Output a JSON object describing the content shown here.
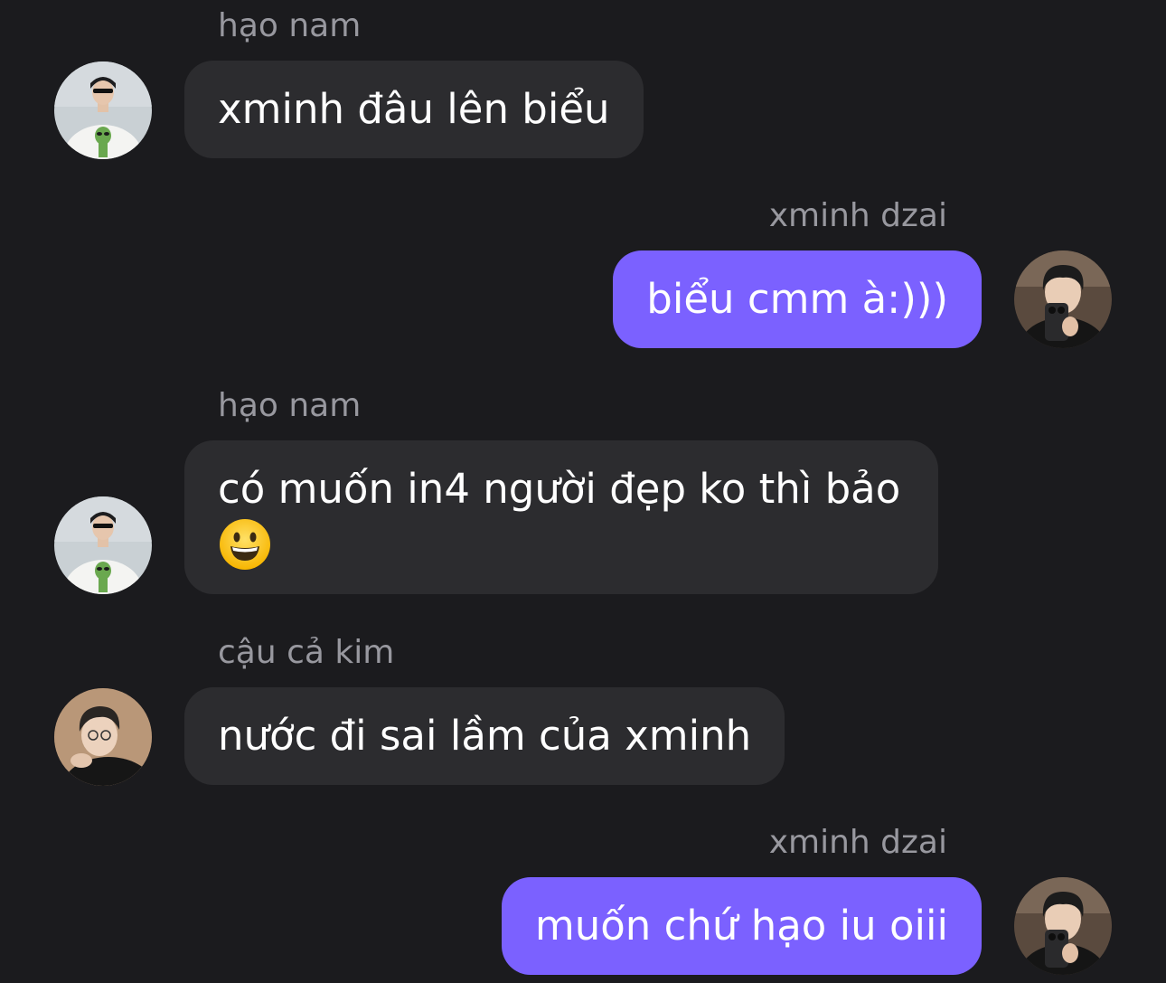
{
  "conversation": {
    "messages": [
      {
        "sender": "hạo nam",
        "text": "xminh đâu lên biểu",
        "side": "incoming",
        "avatar": "avatar-hao-nam"
      },
      {
        "sender": "xminh dzai",
        "text": "biểu cmm à:)))",
        "side": "outgoing",
        "avatar": "avatar-xminh"
      },
      {
        "sender": "hạo nam",
        "text": "có muốn in4 người đẹp ko thì bảo",
        "emoji": "grinning-face-icon",
        "side": "incoming",
        "avatar": "avatar-hao-nam"
      },
      {
        "sender": "cậu cả kim",
        "text": "nước đi sai lầm của xminh",
        "side": "incoming",
        "avatar": "avatar-cau-ca-kim"
      },
      {
        "sender": "xminh dzai",
        "text": "muốn chứ hạo iu oiii",
        "side": "outgoing",
        "avatar": "avatar-xminh"
      }
    ]
  },
  "colors": {
    "background": "#1b1b1e",
    "incoming_bubble": "#2c2c2f",
    "outgoing_bubble": "#7b61ff",
    "sender_name": "#98989f",
    "message_text": "#ffffff"
  }
}
